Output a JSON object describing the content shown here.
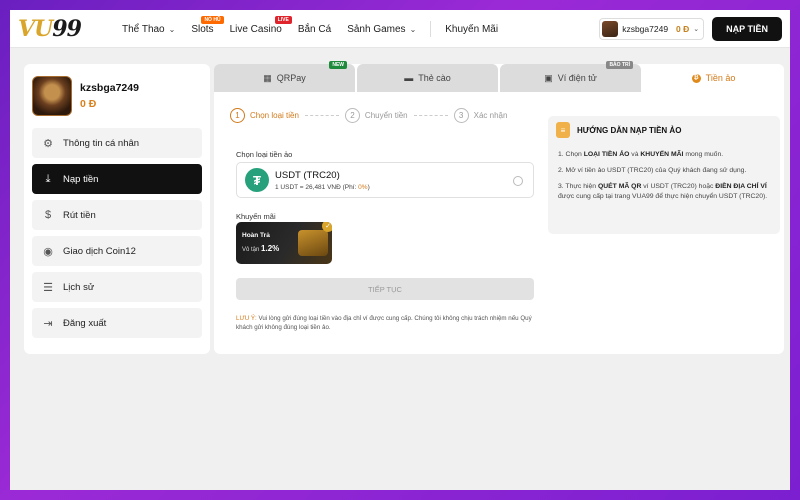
{
  "header": {
    "logo": {
      "text_left": "VU",
      "text_right": "99"
    },
    "nav": [
      {
        "label": "Thể Thao",
        "chevron": true
      },
      {
        "label": "Slots",
        "tag": "NỔ HŨ"
      },
      {
        "label": "Live Casino",
        "tag": "LIVE"
      },
      {
        "label": "Bắn Cá"
      },
      {
        "label": "Sảnh Games",
        "chevron": true
      },
      {
        "label": "Khuyến Mãi"
      }
    ],
    "user": {
      "name": "kzsbga7249",
      "balance": "0 Đ"
    },
    "deposit_button": "NẠP TIỀN"
  },
  "sidebar": {
    "username": "kzsbga7249",
    "balance": "0 Đ",
    "items": [
      {
        "label": "Thông tin cá nhân",
        "icon": "user-settings-icon",
        "active": false
      },
      {
        "label": "Nạp tiền",
        "icon": "deposit-icon",
        "active": true
      },
      {
        "label": "Rút tiền",
        "icon": "withdraw-icon",
        "active": false
      },
      {
        "label": "Giao dịch Coin12",
        "icon": "coin-icon",
        "active": false
      },
      {
        "label": "Lịch sử",
        "icon": "history-icon",
        "active": false
      },
      {
        "label": "Đăng xuất",
        "icon": "logout-icon",
        "active": false
      }
    ]
  },
  "tabs": [
    {
      "label": "QRPay",
      "badge": "NEW"
    },
    {
      "label": "Thẻ cào"
    },
    {
      "label": "Ví điện tử",
      "badge": "BẢO TRÌ"
    },
    {
      "label": "Tiền ảo",
      "active": true
    }
  ],
  "steps": [
    {
      "num": "1",
      "label": "Chọn loại tiền"
    },
    {
      "num": "2",
      "label": "Chuyển tiền"
    },
    {
      "num": "3",
      "label": "Xác nhận"
    }
  ],
  "form": {
    "currency_label": "Chọn loại tiền ảo",
    "currency_name": "USDT (TRC20)",
    "currency_rate": "1 USDT = 26,481 VNĐ (Phí: ",
    "currency_fee": "0%",
    "currency_rate_end": ")",
    "promo_label": "Khuyến mãi",
    "promo_title": "Hoàn Trả",
    "promo_sub": "Vô tận ",
    "promo_value": "1.2%",
    "continue_button": "TIẾP TỤC",
    "note_warn": "LƯU Ý:",
    "note_text": " Vui lòng gửi đúng loại tiền vào địa chỉ ví được cung cấp. Chúng tôi không chịu trách nhiệm nếu Quý khách gửi không đúng loại tiền ảo."
  },
  "guide": {
    "title": "HƯỚNG DẪN NẠP TIỀN ẢO",
    "step1_a": "1. Chọn ",
    "step1_b1": "LOẠI TIỀN ẢO",
    "step1_c": " và ",
    "step1_b2": "KHUYẾN MÃI",
    "step1_d": " mong muốn.",
    "step2": "2. Mở ví tiền ảo USDT (TRC20) của Quý khách đang sử dụng.",
    "step3_a": "3. Thực hiện ",
    "step3_b1": "QUÉT MÃ QR",
    "step3_c": " ví USDT (TRC20) hoặc ",
    "step3_b2": "ĐIỀN ĐỊA CHỈ VÍ",
    "step3_d": " được cung cấp tại trang VUA99 để thực hiện chuyển USDT (TRC20)."
  },
  "colors": {
    "accent": "#d17a1a",
    "tether": "#26a17b",
    "active_menu": "#111111"
  }
}
